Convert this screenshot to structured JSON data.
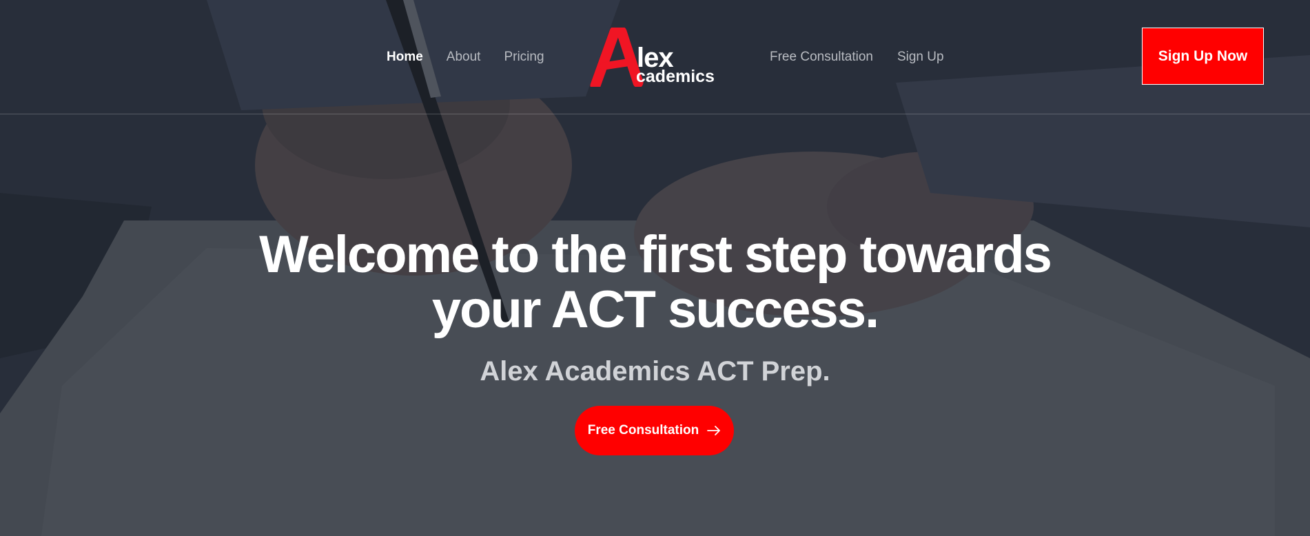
{
  "nav": {
    "left": [
      {
        "label": "Home",
        "active": true
      },
      {
        "label": "About",
        "active": false
      },
      {
        "label": "Pricing",
        "active": false
      }
    ],
    "right": [
      {
        "label": "Free Consultation",
        "active": false
      },
      {
        "label": "Sign Up",
        "active": false
      }
    ]
  },
  "logo": {
    "letter": "A",
    "line1": "lex",
    "line2": "cademics"
  },
  "header_cta": {
    "label": "Sign Up Now"
  },
  "hero": {
    "headline_line1": "Welcome to the first step towards",
    "headline_line2": "your ACT success.",
    "subheadline": "Alex Academics ACT Prep.",
    "cta_label": "Free Consultation",
    "cta_icon": "arrow-right-icon"
  },
  "colors": {
    "accent": "#ff0000",
    "nav_inactive": "#b9bcc2",
    "text_primary": "#ffffff"
  }
}
